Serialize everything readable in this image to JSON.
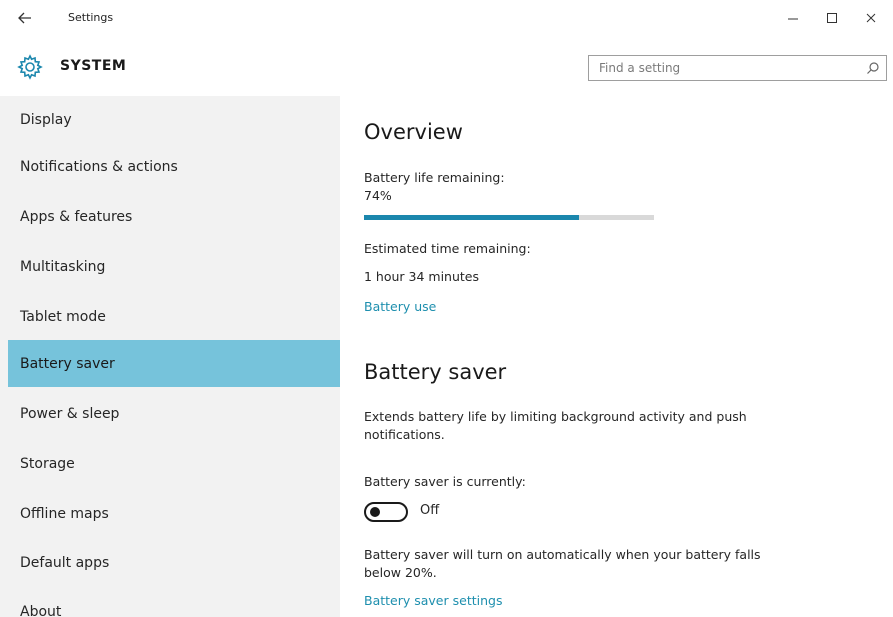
{
  "window": {
    "title": "Settings",
    "back_icon": "arrow-left-icon",
    "controls": [
      "minimize-icon",
      "maximize-icon",
      "close-icon"
    ]
  },
  "header": {
    "icon": "gear-icon",
    "title": "SYSTEM",
    "search_placeholder": "Find a setting",
    "search_value": ""
  },
  "sidebar": {
    "selected_color": "#76c3db",
    "items": [
      {
        "label": "Display"
      },
      {
        "label": "Notifications & actions"
      },
      {
        "label": "Apps & features"
      },
      {
        "label": "Multitasking"
      },
      {
        "label": "Tablet mode"
      },
      {
        "label": "Battery saver",
        "selected": true
      },
      {
        "label": "Power & sleep"
      },
      {
        "label": "Storage"
      },
      {
        "label": "Offline maps"
      },
      {
        "label": "Default apps"
      },
      {
        "label": "About"
      }
    ]
  },
  "main": {
    "overview": {
      "heading": "Overview",
      "battery_label": "Battery life remaining:",
      "battery_value": "74%",
      "battery_fraction": 0.74,
      "estimated_label": "Estimated time remaining:",
      "estimated_value": "1 hour 34 minutes",
      "battery_use_link": "Battery use"
    },
    "battery_saver": {
      "heading": "Battery saver",
      "description_line1": "Extends battery life by limiting background activity and push",
      "description_line2": "notifications.",
      "status_label": "Battery saver is currently:",
      "toggle_state": "Off",
      "auto_line1": "Battery saver will turn on automatically when your battery falls",
      "auto_line2": "below 20%.",
      "settings_link": "Battery saver settings"
    },
    "accent_color": "#1b87ad"
  }
}
